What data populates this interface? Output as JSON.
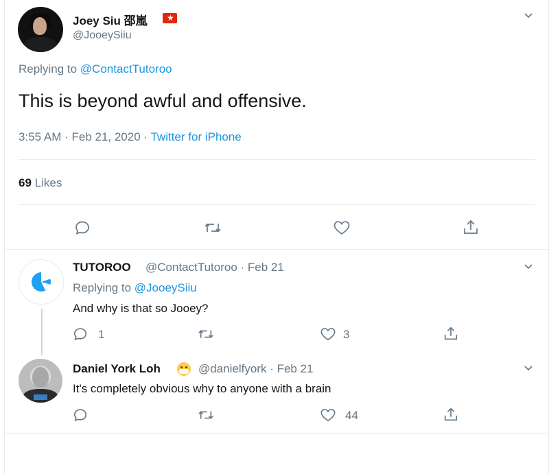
{
  "main_tweet": {
    "author_name": "Joey Siu 邵嵐",
    "flag_glyph": "★",
    "handle": "@JooeySiiu",
    "replying_prefix": "Replying to",
    "replying_to": "@ContactTutoroo",
    "text": "This is beyond awful and offensive.",
    "timestamp": "3:55 AM · Feb 21, 2020 · ",
    "source": "Twitter for iPhone",
    "likes_count": "69",
    "likes_label": "Likes"
  },
  "replies": [
    {
      "author_name": "TUTOROO",
      "meta": "@ContactTutoroo · Feb 21",
      "replying_prefix": "Replying to",
      "replying_to": "@JooeySiiu",
      "text": "And why is that so Jooey?",
      "reply_count": "1",
      "retweet_count": "",
      "like_count": "3"
    },
    {
      "author_name": "Daniel York Loh",
      "meta": "@danielfyork · Feb 21",
      "text": "It's completely obvious why to anyone with a brain",
      "reply_count": "",
      "retweet_count": "",
      "like_count": "44"
    }
  ],
  "icons": {
    "reply": "reply-icon",
    "retweet": "retweet-icon",
    "like": "heart-icon",
    "share": "share-icon",
    "more": "chevron-down-icon"
  },
  "colors": {
    "link": "#1b95e0",
    "secondary_text": "#657786",
    "divider": "#e6ecf0",
    "tutoroo_logo": "#1da1f2"
  }
}
